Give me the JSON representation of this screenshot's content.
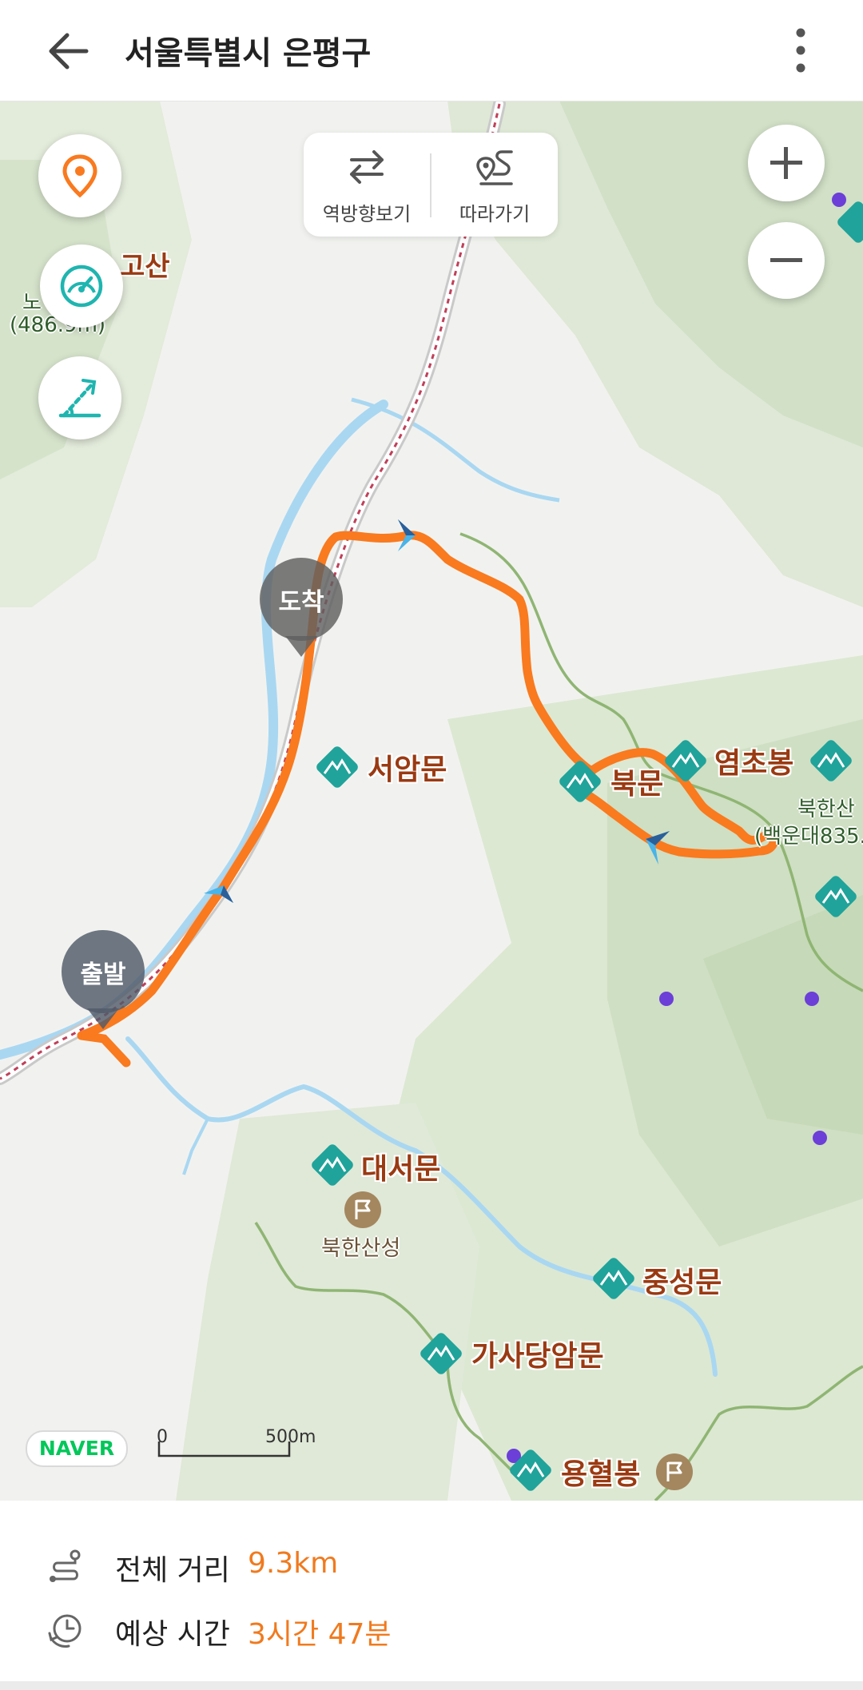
{
  "header": {
    "title": "서울특별시 은평구"
  },
  "map": {
    "route_tools": {
      "reverse_label": "역방향보기",
      "follow_label": "따라가기"
    },
    "markers": {
      "start_label": "출발",
      "end_label": "도착"
    },
    "pois": [
      {
        "name": "서암문"
      },
      {
        "name": "북문"
      },
      {
        "name": "염초봉"
      },
      {
        "name": "대서문"
      },
      {
        "name": "중성문"
      },
      {
        "name": "가사당암문"
      },
      {
        "name": "용혈봉"
      }
    ],
    "partial_labels": {
      "top_left_peak": "고산",
      "top_left_sub": "노",
      "top_left_elev": "(486.9m)",
      "right_mountain": "북한산",
      "right_mountain_sub": "(백운대835."
    },
    "fortress_label": "북한산성",
    "brand_badge": "NAVER",
    "scale": {
      "zero": "0",
      "length": "500m"
    },
    "colors": {
      "route": "#f97a1f",
      "poi_teal": "#20a39a",
      "water": "#a9d7f2"
    }
  },
  "summary": {
    "distance_label": "전체 거리",
    "distance_value": "9.3km",
    "time_label": "예상 시간",
    "time_value": "3시간 47분"
  }
}
